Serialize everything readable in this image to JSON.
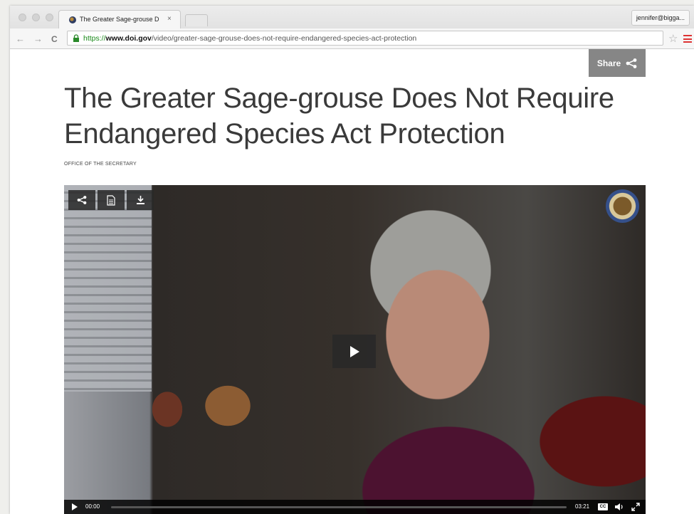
{
  "browser": {
    "tab_title": "The Greater Sage-grouse D",
    "tab_close": "×",
    "profile": "jennifer@bigga...",
    "url": {
      "scheme": "https://",
      "host": "www.doi.gov",
      "path": "/video/greater-sage-grouse-does-not-require-endangered-species-act-protection"
    },
    "nav": {
      "back": "←",
      "forward": "→",
      "reload": "C"
    },
    "star": "☆"
  },
  "page": {
    "share_label": "Share",
    "title": "The Greater Sage-grouse Does Not Require Endangered Species Act Protection",
    "office": "OFFICE OF THE SECRETARY"
  },
  "video": {
    "current_time": "00:00",
    "duration": "03:21",
    "cc_label": "CC",
    "progress": 0
  },
  "icons": [
    "share-icon",
    "document-icon",
    "download-icon",
    "play-icon",
    "volume-icon",
    "fullscreen-icon",
    "lock-icon",
    "star-icon",
    "menu-icon",
    "seal-logo"
  ]
}
